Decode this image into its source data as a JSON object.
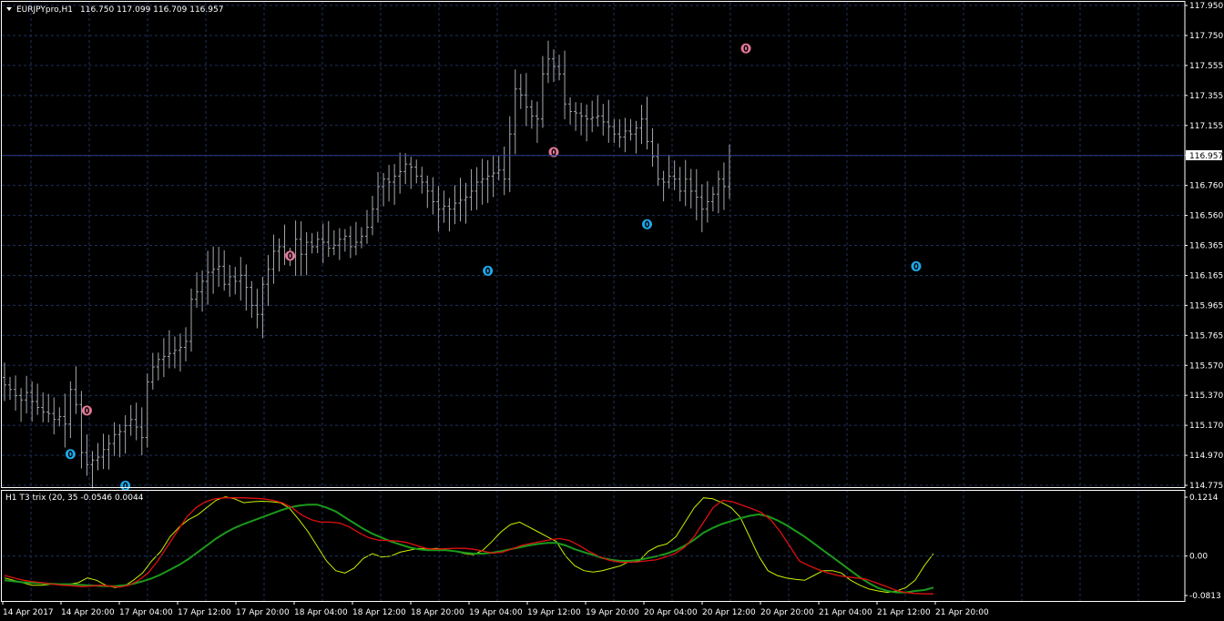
{
  "colors": {
    "background": "#000000",
    "grid": "#1f2f5a",
    "bar": "#a6a8ae",
    "bid_line": "#2a3c8a",
    "trix_fast": "#c8f000",
    "trix_slow": "#1a9a1a",
    "trix_signal": "#e01010",
    "marker_up": "#1ea8e8",
    "marker_down": "#e07896"
  },
  "main_legend": {
    "symbol": "EURJPYpro,H1",
    "ohlc": "116.750 117.099 116.709 116.957",
    "menu_icon": "triangle-down-icon"
  },
  "current_price": "116.957",
  "indicator_legend": "H1 T3 trix (20, 35 -0.0546 0.0044",
  "chart_data": [
    {
      "type": "candlestick-bar",
      "price_axis_labels": [
        "117.950",
        "117.750",
        "117.555",
        "117.355",
        "117.155",
        "116.957",
        "116.760",
        "116.560",
        "116.365",
        "116.165",
        "115.965",
        "115.765",
        "115.570",
        "115.370",
        "115.170",
        "114.970",
        "114.775"
      ],
      "time_axis_labels": [
        "14 Apr 2017",
        "14 Apr 20:00",
        "17 Apr 04:00",
        "17 Apr 12:00",
        "17 Apr 20:00",
        "18 Apr 04:00",
        "18 Apr 12:00",
        "18 Apr 20:00",
        "19 Apr 04:00",
        "19 Apr 12:00",
        "19 Apr 20:00",
        "20 Apr 04:00",
        "20 Apr 12:00",
        "20 Apr 20:00",
        "21 Apr 04:00",
        "21 Apr 12:00",
        "21 Apr 20:00"
      ],
      "ylim": [
        114.75,
        117.98
      ],
      "series_close": [
        115.43,
        115.4,
        115.36,
        115.33,
        115.38,
        115.32,
        115.28,
        115.25,
        115.24,
        115.2,
        115.22,
        115.17,
        115.4,
        115.3,
        114.98,
        114.9,
        114.93,
        114.95,
        115.0,
        115.04,
        115.1,
        115.12,
        115.16,
        115.2,
        115.15,
        115.08,
        115.45,
        115.55,
        115.6,
        115.62,
        115.64,
        115.66,
        115.68,
        115.72,
        116.0,
        116.05,
        116.12,
        116.18,
        116.2,
        116.22,
        116.1,
        116.15,
        116.12,
        116.16,
        116.08,
        115.96,
        115.9,
        116.1,
        116.2,
        116.32,
        116.35,
        116.3,
        116.28,
        116.4,
        116.3,
        116.38,
        116.35,
        116.4,
        116.38,
        116.34,
        116.36,
        116.4,
        116.42,
        116.35,
        116.38,
        116.42,
        116.48,
        116.6,
        116.75,
        116.8,
        116.78,
        116.82,
        116.85,
        116.9,
        116.88,
        116.82,
        116.78,
        116.72,
        116.65,
        116.6,
        116.62,
        116.6,
        116.64,
        116.66,
        116.68,
        116.72,
        116.78,
        116.8,
        116.82,
        116.84,
        116.86,
        116.8,
        117.1,
        117.4,
        117.36,
        117.28,
        117.22,
        117.2,
        117.5,
        117.6,
        117.55,
        117.5,
        117.3,
        117.25,
        117.24,
        117.22,
        117.2,
        117.21,
        117.22,
        117.18,
        117.15,
        117.1,
        117.08,
        117.12,
        117.1,
        117.14,
        117.2,
        117.05,
        116.95,
        116.8,
        116.78,
        116.82,
        116.8,
        116.72,
        116.8,
        116.72,
        116.68,
        116.6,
        116.65,
        116.7,
        116.8,
        116.75,
        116.957
      ]
    },
    {
      "type": "line",
      "axis_labels": [
        "0.1214",
        "0.00",
        "-0.0813"
      ],
      "ylim": [
        -0.0813,
        0.1214
      ],
      "series": [
        {
          "name": "",
          "values": [
            -0.045,
            -0.05,
            -0.055,
            -0.06,
            -0.06,
            -0.058,
            -0.058,
            -0.058,
            -0.055,
            -0.045,
            -0.05,
            -0.06,
            -0.065,
            -0.062,
            -0.05,
            -0.035,
            -0.01,
            0.01,
            0.04,
            0.06,
            0.075,
            0.085,
            0.1,
            0.115,
            0.122,
            0.118,
            0.11,
            0.112,
            0.113,
            0.112,
            0.11,
            0.098,
            0.075,
            0.05,
            0.02,
            -0.01,
            -0.03,
            -0.035,
            -0.025,
            -0.005,
            0.005,
            -0.002,
            0.0,
            0.008,
            0.012,
            0.016,
            0.015,
            0.016,
            0.013,
            0.01,
            0.005,
            0.003,
            0.012,
            0.03,
            0.05,
            0.065,
            0.07,
            0.06,
            0.05,
            0.04,
            0.03,
            0.0,
            -0.02,
            -0.03,
            -0.033,
            -0.03,
            -0.025,
            -0.02,
            -0.01,
            -0.01,
            0.01,
            0.02,
            0.025,
            0.04,
            0.07,
            0.1,
            0.12,
            0.118,
            0.11,
            0.1,
            0.08,
            0.04,
            0.0,
            -0.03,
            -0.04,
            -0.045,
            -0.048,
            -0.05,
            -0.04,
            -0.03,
            -0.03,
            -0.035,
            -0.05,
            -0.06,
            -0.068,
            -0.072,
            -0.075,
            -0.072,
            -0.065,
            -0.05,
            -0.02,
            0.005
          ]
        },
        {
          "name": "",
          "values": [
            -0.05,
            -0.052,
            -0.054,
            -0.055,
            -0.056,
            -0.057,
            -0.058,
            -0.058,
            -0.059,
            -0.06,
            -0.061,
            -0.062,
            -0.062,
            -0.06,
            -0.057,
            -0.052,
            -0.046,
            -0.038,
            -0.028,
            -0.018,
            -0.006,
            0.008,
            0.022,
            0.036,
            0.048,
            0.058,
            0.066,
            0.073,
            0.08,
            0.087,
            0.094,
            0.1,
            0.104,
            0.106,
            0.106,
            0.1,
            0.092,
            0.08,
            0.068,
            0.056,
            0.046,
            0.038,
            0.03,
            0.024,
            0.018,
            0.014,
            0.012,
            0.012,
            0.012,
            0.01,
            0.007,
            0.005,
            0.005,
            0.007,
            0.01,
            0.014,
            0.018,
            0.022,
            0.025,
            0.027,
            0.027,
            0.022,
            0.014,
            0.008,
            0.002,
            -0.004,
            -0.008,
            -0.01,
            -0.01,
            -0.008,
            -0.004,
            0.0,
            0.005,
            0.012,
            0.022,
            0.034,
            0.048,
            0.058,
            0.066,
            0.072,
            0.078,
            0.083,
            0.086,
            0.082,
            0.074,
            0.064,
            0.052,
            0.04,
            0.026,
            0.012,
            -0.002,
            -0.016,
            -0.03,
            -0.044,
            -0.056,
            -0.066,
            -0.072,
            -0.075,
            -0.075,
            -0.072,
            -0.07,
            -0.065
          ]
        },
        {
          "name": "",
          "values": [
            -0.04,
            -0.045,
            -0.05,
            -0.053,
            -0.055,
            -0.058,
            -0.06,
            -0.061,
            -0.063,
            -0.062,
            -0.06,
            -0.062,
            -0.064,
            -0.06,
            -0.05,
            -0.035,
            -0.01,
            0.02,
            0.05,
            0.08,
            0.1,
            0.112,
            0.118,
            0.12,
            0.12,
            0.12,
            0.119,
            0.118,
            0.115,
            0.11,
            0.1,
            0.085,
            0.075,
            0.07,
            0.07,
            0.068,
            0.06,
            0.048,
            0.038,
            0.033,
            0.032,
            0.031,
            0.028,
            0.022,
            0.016,
            0.014,
            0.015,
            0.016,
            0.016,
            0.014,
            0.01,
            0.006,
            0.008,
            0.015,
            0.022,
            0.026,
            0.03,
            0.034,
            0.036,
            0.032,
            0.022,
            0.01,
            0.0,
            -0.008,
            -0.012,
            -0.013,
            -0.012,
            -0.01,
            -0.008,
            -0.002,
            0.005,
            0.018,
            0.04,
            0.07,
            0.1,
            0.115,
            0.112,
            0.105,
            0.098,
            0.09,
            0.075,
            0.05,
            0.02,
            -0.01,
            -0.02,
            -0.028,
            -0.035,
            -0.04,
            -0.043,
            -0.045,
            -0.048,
            -0.055,
            -0.062,
            -0.07,
            -0.075,
            -0.077,
            -0.078,
            -0.078
          ]
        }
      ]
    }
  ],
  "markers": [
    {
      "type": "up",
      "bar": 12,
      "price": 114.97
    },
    {
      "type": "down",
      "bar": 15,
      "price": 115.26
    },
    {
      "type": "up",
      "bar": 22,
      "price": 114.76
    },
    {
      "type": "down",
      "bar": 52,
      "price": 116.29
    },
    {
      "type": "up",
      "bar": 88,
      "price": 116.19
    },
    {
      "type": "down",
      "bar": 100,
      "price": 116.98
    },
    {
      "type": "up",
      "bar": 117,
      "price": 116.5
    },
    {
      "type": "down",
      "bar": 135,
      "price": 117.67
    },
    {
      "type": "up",
      "bar": 166,
      "price": 116.22
    }
  ]
}
